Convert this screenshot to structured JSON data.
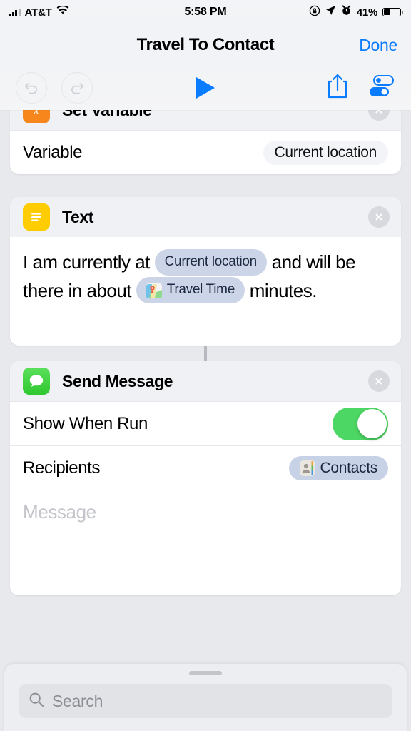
{
  "status_bar": {
    "signal_icon": "cellular-bars-icon",
    "carrier": "AT&T",
    "wifi_icon": "wifi-icon",
    "time": "5:58 PM",
    "rotation_lock_icon": "rotation-lock-icon",
    "location_icon": "location-arrow-icon",
    "alarm_icon": "alarm-clock-icon",
    "battery_percent": "41%",
    "battery_level": 41
  },
  "nav": {
    "title": "Travel To Contact",
    "done_label": "Done",
    "done_color": "#0a7cff"
  },
  "toolbar": {
    "undo_icon": "undo-icon",
    "redo_icon": "redo-icon",
    "play_icon": "play-icon",
    "share_icon": "share-icon",
    "settings_icon": "toggles-settings-icon",
    "accent_color": "#0a7cff"
  },
  "actions": [
    {
      "id": "set-variable",
      "title": "Set Variable",
      "icon": "variable-icon",
      "icon_color": "#f7861c",
      "clipped_top": true,
      "rows": [
        {
          "label": "Variable",
          "token": "Current location",
          "token_style": "grey"
        }
      ]
    },
    {
      "id": "text",
      "title": "Text",
      "icon": "text-lines-icon",
      "icon_color": "#ffcc00",
      "body": {
        "segments": [
          {
            "type": "text",
            "value": "I am currently at "
          },
          {
            "type": "token",
            "value": "Current location",
            "icon": null
          },
          {
            "type": "text",
            "value": " and will be there in about "
          },
          {
            "type": "token",
            "value": "Travel Time",
            "icon": "maps-icon"
          },
          {
            "type": "text",
            "value": " minutes."
          }
        ]
      }
    },
    {
      "id": "send-message",
      "title": "Send Message",
      "icon": "messages-icon",
      "icon_color": "#2fc82f",
      "rows": [
        {
          "label": "Show When Run",
          "control": "toggle",
          "value": true,
          "toggle_color": "#4cd663"
        },
        {
          "label": "Recipients",
          "token": "Contacts",
          "token_style": "blue",
          "token_icon": "contacts-icon"
        }
      ],
      "message_placeholder": "Message"
    }
  ],
  "bottom_sheet": {
    "grabber": "sheet-grabber",
    "search_icon": "search-icon",
    "search_value": "",
    "search_placeholder": "Search"
  }
}
